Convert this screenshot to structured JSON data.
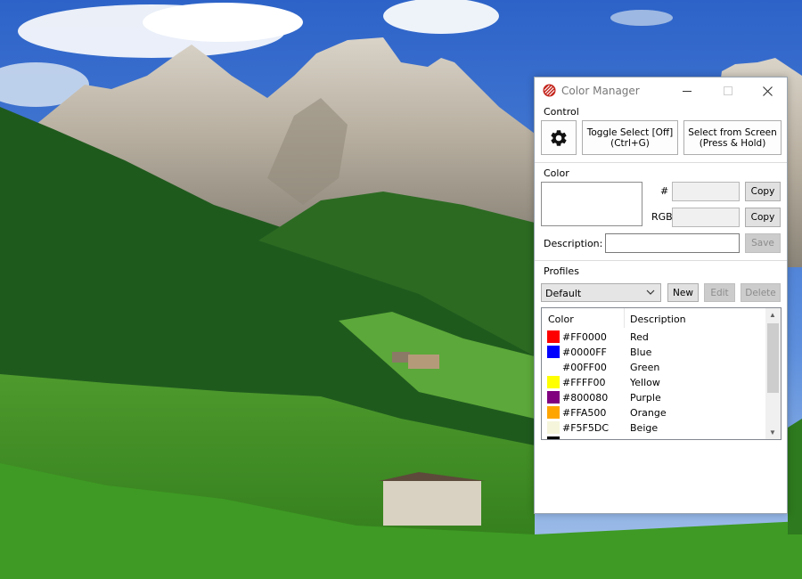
{
  "window": {
    "title": "Color Manager",
    "minimize_icon": "minimize-icon",
    "maximize_icon": "maximize-icon",
    "close_icon": "close-icon"
  },
  "control": {
    "section_label": "Control",
    "settings_icon": "gear-icon",
    "toggle_select_line1": "Toggle Select [Off]",
    "toggle_select_line2": "(Ctrl+G)",
    "select_from_screen_line1": "Select from Screen",
    "select_from_screen_line2": "(Press & Hold)"
  },
  "color": {
    "section_label": "Color",
    "hex_label": "#",
    "hex_value": "",
    "rgb_label": "RGB",
    "rgb_value": "",
    "copy_label": "Copy",
    "description_label": "Description:",
    "description_value": "",
    "save_label": "Save"
  },
  "profiles": {
    "section_label": "Profiles",
    "selected_profile": "Default",
    "new_label": "New",
    "edit_label": "Edit",
    "delete_label": "Delete",
    "columns": [
      "Color",
      "Description"
    ],
    "rows": [
      {
        "hex": "#FF0000",
        "description": "Red",
        "swatch": "#FF0000"
      },
      {
        "hex": "#0000FF",
        "description": "Blue",
        "swatch": "#0000FF"
      },
      {
        "hex": "#00FF00",
        "description": "Green",
        "swatch": "#FFFFFF"
      },
      {
        "hex": "#FFFF00",
        "description": "Yellow",
        "swatch": "#FFFF00"
      },
      {
        "hex": "#800080",
        "description": "Purple",
        "swatch": "#800080"
      },
      {
        "hex": "#FFA500",
        "description": "Orange",
        "swatch": "#FFA500"
      },
      {
        "hex": "#F5F5DC",
        "description": "Beige",
        "swatch": "#F5F5DC"
      }
    ]
  }
}
